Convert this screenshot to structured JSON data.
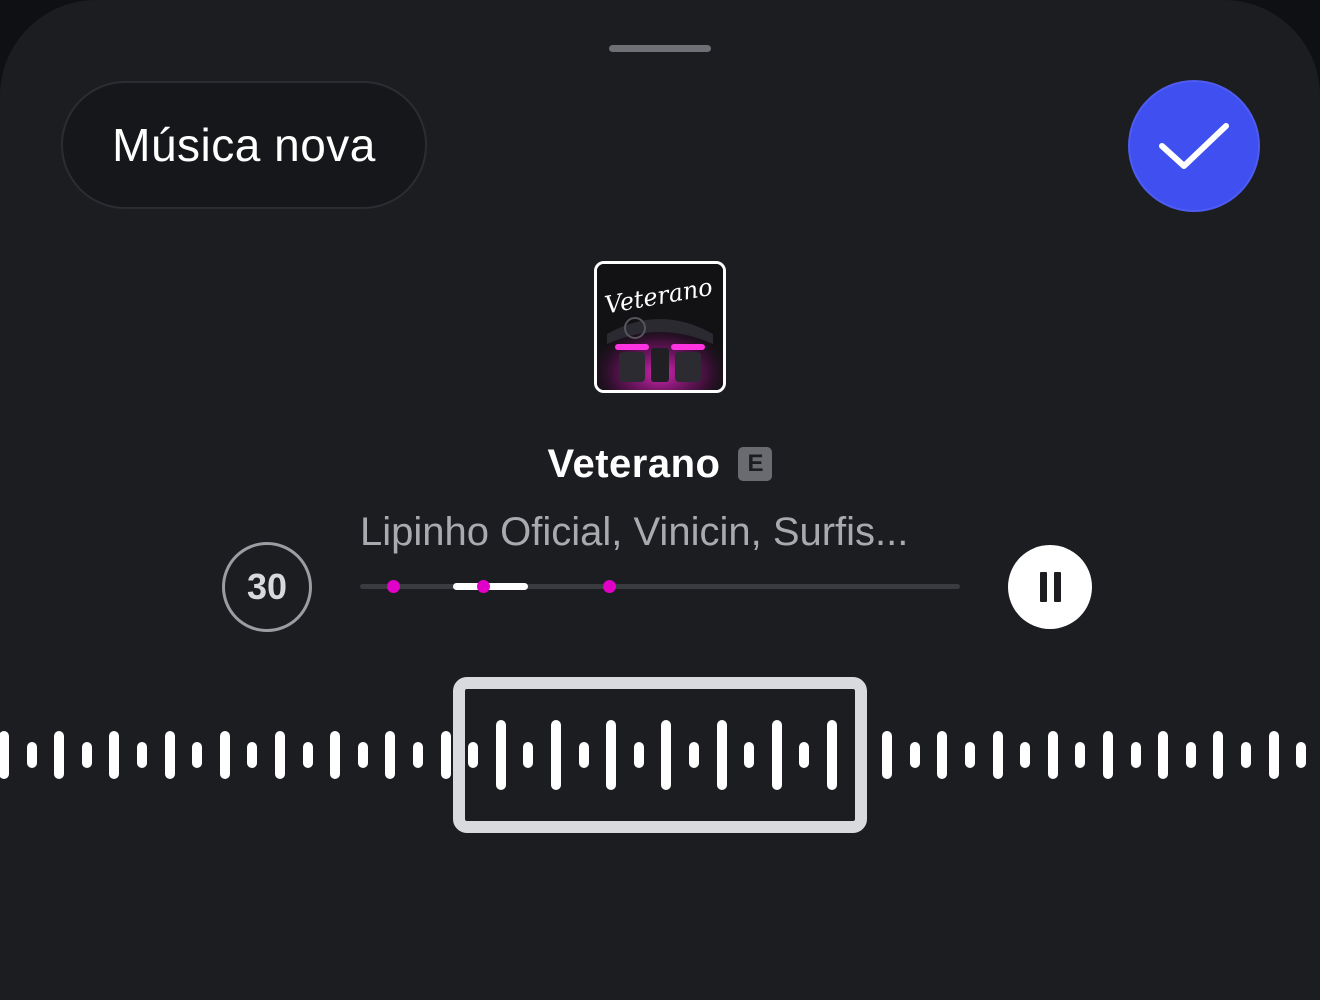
{
  "header": {
    "title": "Música nova",
    "confirm_icon": "checkmark-icon"
  },
  "track": {
    "cover_title": "Veterano",
    "title": "Veterano",
    "explicit_badge": "E",
    "artists": "Lipinho Oficial, Vinicin, Surfis...",
    "clip_duration": "30",
    "selection_fraction": {
      "start": 0.155,
      "end": 0.28
    },
    "markers_fraction": [
      0.055,
      0.205,
      0.415
    ]
  },
  "colors": {
    "background": "#1c1d21",
    "accent": "#3f4ff0",
    "marker": "#e000c8",
    "wave": "#ffffff",
    "frame": "#d9dade"
  },
  "controls": {
    "pause_icon": "pause-icon"
  }
}
